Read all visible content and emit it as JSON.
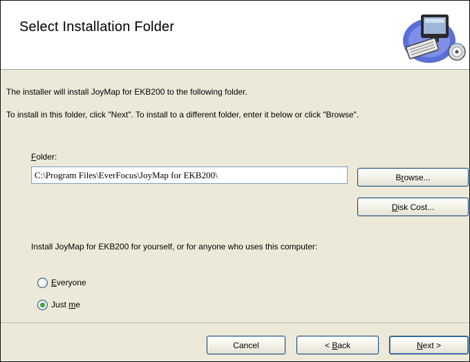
{
  "header": {
    "title": "Select Installation Folder",
    "art_icon": "computer-install-icon"
  },
  "intro": {
    "line1": "The installer will install JoyMap for EKB200 to the following folder.",
    "line2": "To install in this folder, click \"Next\". To install to a different folder, enter it below or click \"Browse\"."
  },
  "folder": {
    "label_accel": "F",
    "label_rest": "older:",
    "value": "C:\\Program Files\\EverFocus\\JoyMap for EKB200\\"
  },
  "buttons": {
    "browse_pre": "B",
    "browse_accel": "r",
    "browse_post": "owse...",
    "disk_accel": "D",
    "disk_post": "isk Cost...",
    "cancel": "Cancel",
    "back_pre": "< ",
    "back_accel": "B",
    "back_post": "ack",
    "next_accel": "N",
    "next_post": "ext >"
  },
  "install_for": {
    "prompt": "Install JoyMap for EKB200 for yourself, or for anyone who uses this computer:",
    "options": [
      {
        "accel": "E",
        "rest": "veryone",
        "selected": false
      },
      {
        "pre": "Just ",
        "accel": "m",
        "rest": "e",
        "selected": true
      }
    ]
  },
  "colors": {
    "dialog_bg": "#ece9d8",
    "header_bg": "#ffffff",
    "button_border": "#003c74",
    "radio_dot": "#3fa83f"
  }
}
